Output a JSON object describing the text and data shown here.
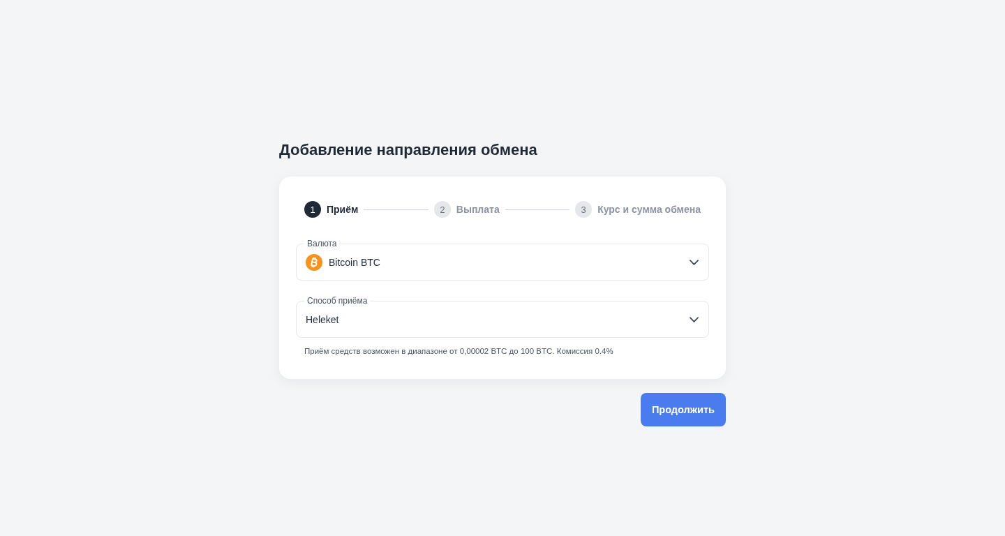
{
  "page": {
    "title": "Добавление направления обмена"
  },
  "steps": [
    {
      "number": "1",
      "label": "Приём",
      "selected": true
    },
    {
      "number": "2",
      "label": "Выплата",
      "selected": false
    },
    {
      "number": "3",
      "label": "Курс и сумма обмена",
      "selected": false
    }
  ],
  "fields": [
    {
      "kind": "coin",
      "label": "Валюта",
      "value": "Bitcoin BTC"
    },
    {
      "kind": "plain",
      "label": "Способ приёма",
      "value": "Heleket"
    }
  ],
  "hint": "Приём средств возможен в диапазоне от 0,00002 BTC до 100 BTC. Комиссия 0.4%",
  "buttons": [
    {
      "label": "Продолжить"
    }
  ]
}
